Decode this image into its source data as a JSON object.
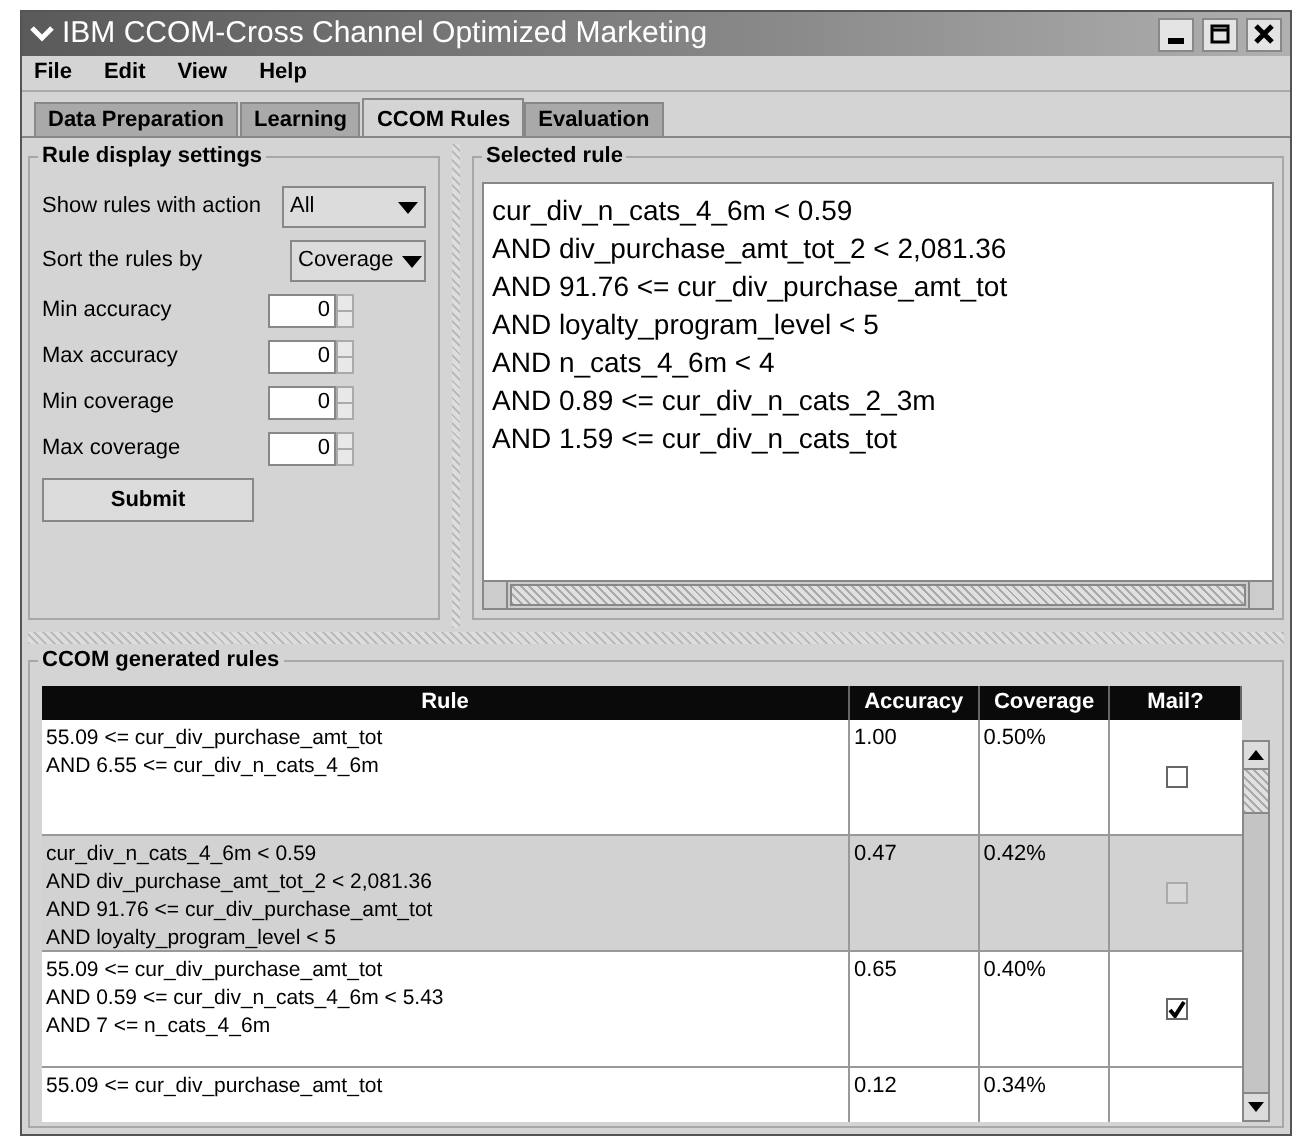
{
  "window": {
    "title": "IBM CCOM-Cross Channel Optimized Marketing"
  },
  "menu": [
    "File",
    "Edit",
    "View",
    "Help"
  ],
  "tabs": [
    {
      "label": "Data Preparation",
      "selected": false
    },
    {
      "label": "Learning",
      "selected": false
    },
    {
      "label": "CCOM Rules",
      "selected": true
    },
    {
      "label": "Evaluation",
      "selected": false
    }
  ],
  "settings": {
    "title": "Rule display settings",
    "dropdowns": [
      {
        "label": "Show rules with action",
        "value": "All"
      },
      {
        "label": "Sort the rules by",
        "value": "Coverage"
      }
    ],
    "spinners": [
      {
        "label": "Min accuracy",
        "value": "0"
      },
      {
        "label": "Max accuracy",
        "value": "0"
      },
      {
        "label": "Min coverage",
        "value": "0"
      },
      {
        "label": "Max coverage",
        "value": "0"
      }
    ],
    "submit": "Submit"
  },
  "selected_rule": {
    "title": "Selected rule",
    "lines": [
      "cur_div_n_cats_4_6m < 0.59",
      "AND div_purchase_amt_tot_2 < 2,081.36",
      "AND 91.76 <= cur_div_purchase_amt_tot",
      "AND loyalty_program_level < 5",
      "AND n_cats_4_6m < 4",
      "AND 0.89 <= cur_div_n_cats_2_3m",
      "AND 1.59 <= cur_div_n_cats_tot"
    ]
  },
  "rules": {
    "title": "CCOM generated rules",
    "columns": [
      "Rule",
      "Accuracy",
      "Coverage",
      "Mail?"
    ],
    "rows": [
      {
        "rule": [
          "55.09 <= cur_div_purchase_amt_tot",
          "AND 6.55 <= cur_div_n_cats_4_6m"
        ],
        "accuracy": "1.00",
        "coverage": "0.50%",
        "selected": false,
        "mail": false
      },
      {
        "rule": [
          "cur_div_n_cats_4_6m < 0.59",
          "AND div_purchase_amt_tot_2 < 2,081.36",
          "AND 91.76 <= cur_div_purchase_amt_tot",
          "AND loyalty_program_level < 5"
        ],
        "accuracy": "0.47",
        "coverage": "0.42%",
        "selected": true,
        "mail": false
      },
      {
        "rule": [
          "55.09 <= cur_div_purchase_amt_tot",
          "AND 0.59 <= cur_div_n_cats_4_6m < 5.43",
          "AND 7 <= n_cats_4_6m"
        ],
        "accuracy": "0.65",
        "coverage": "0.40%",
        "selected": false,
        "mail": true
      },
      {
        "rule": [
          "55.09 <= cur_div_purchase_amt_tot"
        ],
        "accuracy": "0.12",
        "coverage": "0.34%",
        "selected": false
      }
    ]
  }
}
